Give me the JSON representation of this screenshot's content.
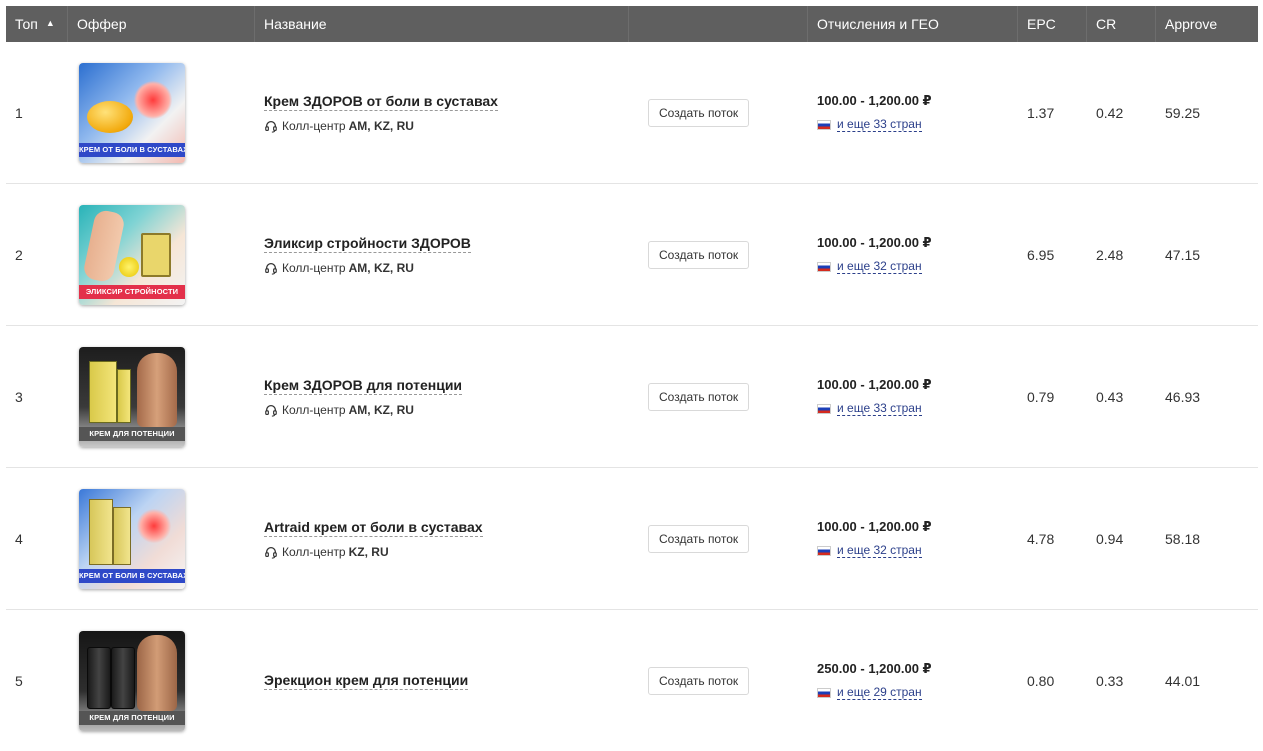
{
  "header": {
    "top": "Топ",
    "offer": "Оффер",
    "name": "Название",
    "payouts": "Отчисления и ГЕО",
    "epc": "EPC",
    "cr": "CR",
    "approve": "Approve"
  },
  "colors": {
    "header_bg": "#5f5f5f",
    "link": "#2b3f8a",
    "banner_blue": "#2f49c8",
    "banner_red": "#e3304a",
    "banner_gray": "#555555"
  },
  "rows": [
    {
      "rank": "1",
      "title": "Крем ЗДОРОВ от боли в суставах",
      "callcenter_label": "Колл-центр",
      "callcenter_geos": "AM, KZ, RU",
      "button": "Создать поток",
      "payout": "100.00 - 1,200.00 ₽",
      "geo_more": "и еще 33 стран",
      "epc": "1.37",
      "cr": "0.42",
      "approve": "59.25",
      "banner": "КРЕМ ОТ БОЛИ В СУСТАВАХ"
    },
    {
      "rank": "2",
      "title": "Эликсир стройности ЗДОРОВ",
      "callcenter_label": "Колл-центр",
      "callcenter_geos": "AM, KZ, RU",
      "button": "Создать поток",
      "payout": "100.00 - 1,200.00 ₽",
      "geo_more": "и еще 32 стран",
      "epc": "6.95",
      "cr": "2.48",
      "approve": "47.15",
      "banner": "ЭЛИКСИР СТРОЙНОСТИ"
    },
    {
      "rank": "3",
      "title": "Крем ЗДОРОВ для потенции",
      "callcenter_label": "Колл-центр",
      "callcenter_geos": "AM, KZ, RU",
      "button": "Создать поток",
      "payout": "100.00 - 1,200.00 ₽",
      "geo_more": "и еще 33 стран",
      "epc": "0.79",
      "cr": "0.43",
      "approve": "46.93",
      "banner": "КРЕМ ДЛЯ ПОТЕНЦИИ"
    },
    {
      "rank": "4",
      "title": "Artraid крем от боли в суставах",
      "callcenter_label": "Колл-центр",
      "callcenter_geos": "KZ, RU",
      "button": "Создать поток",
      "payout": "100.00 - 1,200.00 ₽",
      "geo_more": "и еще 32 стран",
      "epc": "4.78",
      "cr": "0.94",
      "approve": "58.18",
      "banner": "КРЕМ ОТ БОЛИ В СУСТАВАХ"
    },
    {
      "rank": "5",
      "title": "Эрекцион крем для потенции",
      "button": "Создать поток",
      "payout": "250.00 - 1,200.00 ₽",
      "geo_more": "и еще 29 стран",
      "epc": "0.80",
      "cr": "0.33",
      "approve": "44.01",
      "banner": "КРЕМ ДЛЯ ПОТЕНЦИИ"
    }
  ]
}
